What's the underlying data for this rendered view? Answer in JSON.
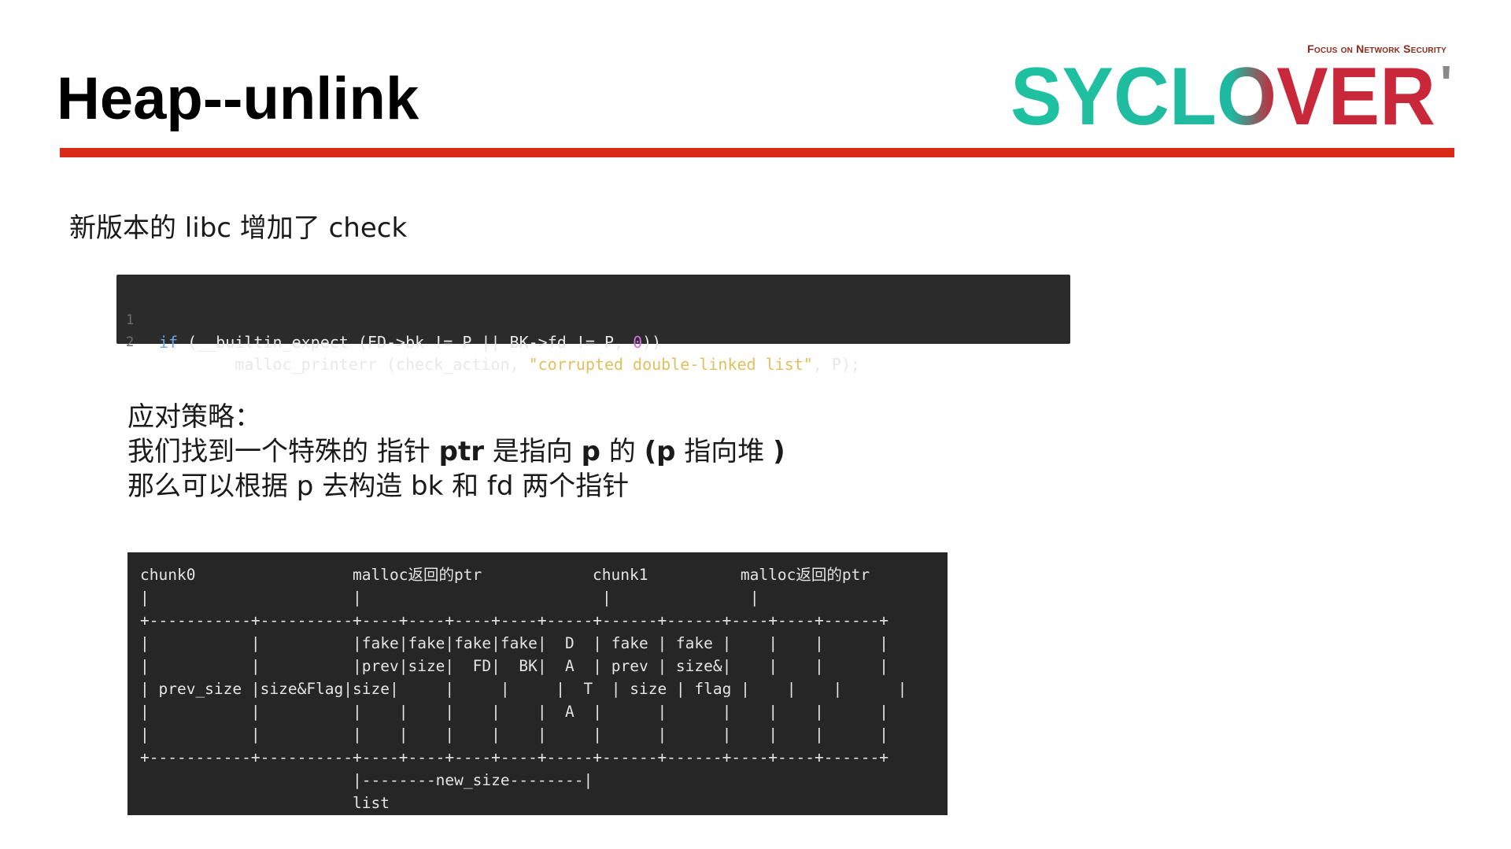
{
  "header": {
    "title": "Heap--unlink",
    "tagline": "Focus on Network Security",
    "logo_text": "SYCLOVER",
    "logo_mark": "'"
  },
  "colors": {
    "rule": "#d92a18",
    "logo_teal": "#1fc3a0",
    "logo_red": "#c8283a",
    "code_bg": "#2b2b2b",
    "terminal_bg": "#262626"
  },
  "intro": "新版本的 libc 增加了 check",
  "code": {
    "lines": [
      {
        "num": "1",
        "text": "if (__builtin_expect (FD->bk != P || BK->fd != P, 0))"
      },
      {
        "num": "2",
        "text": "        malloc_printerr (check_action, \"corrupted double-linked list\", P);"
      }
    ]
  },
  "strategy": {
    "heading": "应对策略：",
    "line2_a": "我们找到一个特殊的 指针 ",
    "line2_b": "ptr",
    "line2_c": " 是指向 ",
    "line2_d": "p",
    "line2_e": " 的 ",
    "line2_f": "(p",
    "line2_g": " 指向堆 ",
    "line2_h": ")",
    "line3": "那么可以根据 p 去构造 bk 和 fd 两个指针"
  },
  "diagram": {
    "lines": [
      "chunk0                 malloc返回的ptr            chunk1          malloc返回的ptr",
      "|                      |                          |               |",
      "+-----------+----------+----+----+----+----+-----+------+------+----+----+------+",
      "|           |          |fake|fake|fake|fake|  D  | fake | fake |    |    |      |",
      "|           |          |prev|size|  FD|  BK|  A  | prev | size&|    |    |      |",
      "| prev_size |size&Flag|size|     |     |     |  T  | size | flag |    |    |      |",
      "|           |          |    |    |    |    |  A  |      |      |    |    |      |",
      "|           |          |    |    |    |    |     |      |      |    |    |      |",
      "+-----------+----------+----+----+----+----+-----+------+------+----+----+------+",
      "                       |--------new_size--------|",
      "                       list"
    ]
  }
}
